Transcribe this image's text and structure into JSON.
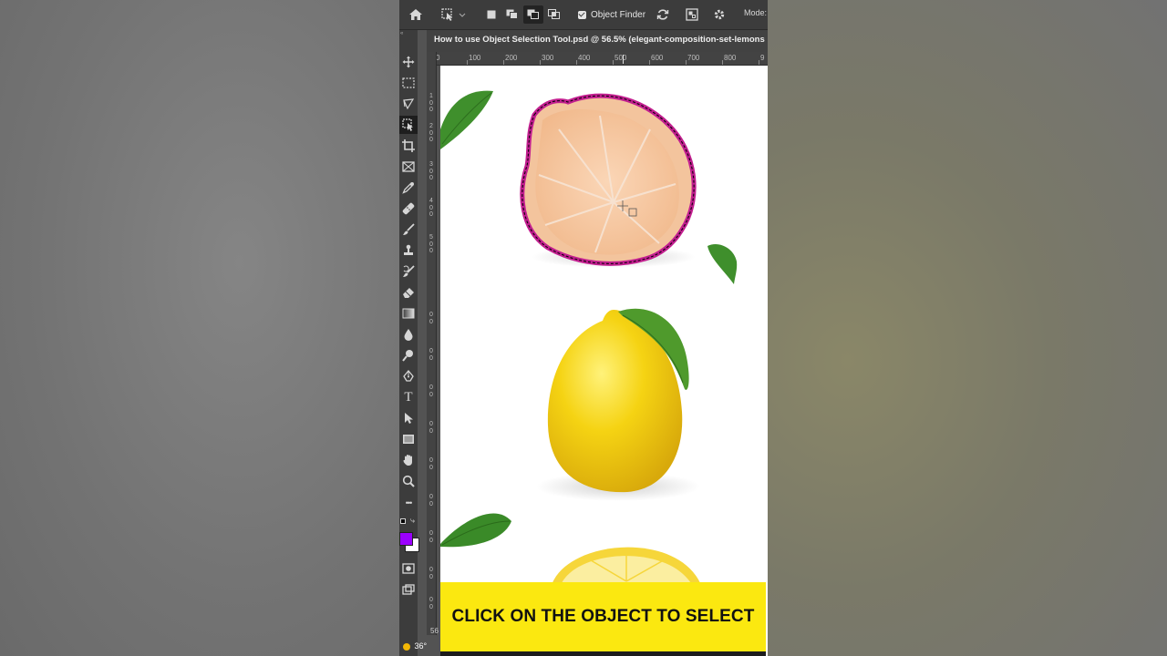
{
  "options_bar": {
    "home_icon": "home-icon",
    "object_finder_label": "Object Finder",
    "object_finder_checked": true,
    "mode_label": "Mode:"
  },
  "document": {
    "tab_title": "How to use Object Selection Tool.psd @ 56.5% (elegant-composition-set-lemons"
  },
  "ruler": {
    "top_labels": [
      "0",
      "100",
      "200",
      "300",
      "400",
      "500",
      "600",
      "700",
      "800",
      "9"
    ],
    "left_labels": [
      "1",
      "2",
      "3",
      "4",
      "5"
    ],
    "bottom_value": "56"
  },
  "toolbar": {
    "tools": [
      "move-tool",
      "marquee-tool",
      "lasso-tool",
      "object-selection-tool",
      "crop-tool",
      "frame-tool",
      "eyedropper-tool",
      "healing-brush-tool",
      "brush-tool",
      "clone-stamp-tool",
      "history-brush-tool",
      "eraser-tool",
      "gradient-tool",
      "blur-tool",
      "dodge-tool",
      "pen-tool",
      "type-tool",
      "path-selection-tool",
      "rectangle-tool",
      "hand-tool",
      "zoom-tool",
      "more-tools"
    ],
    "active_tool": "object-selection-tool",
    "type_glyph": "T",
    "more_glyph": "•••",
    "foreground_color": "#9b00ff",
    "background_color": "#ffffff"
  },
  "caption": {
    "text": "CLICK ON THE OBJECT TO SELECT"
  },
  "taskbar": {
    "temperature": "36°"
  },
  "colors": {
    "selection_overlay": "#d92fa6",
    "banner_yellow": "#fbe810",
    "lemon_yellow": "#f5d20f",
    "leaf_green": "#3f8f2c"
  }
}
